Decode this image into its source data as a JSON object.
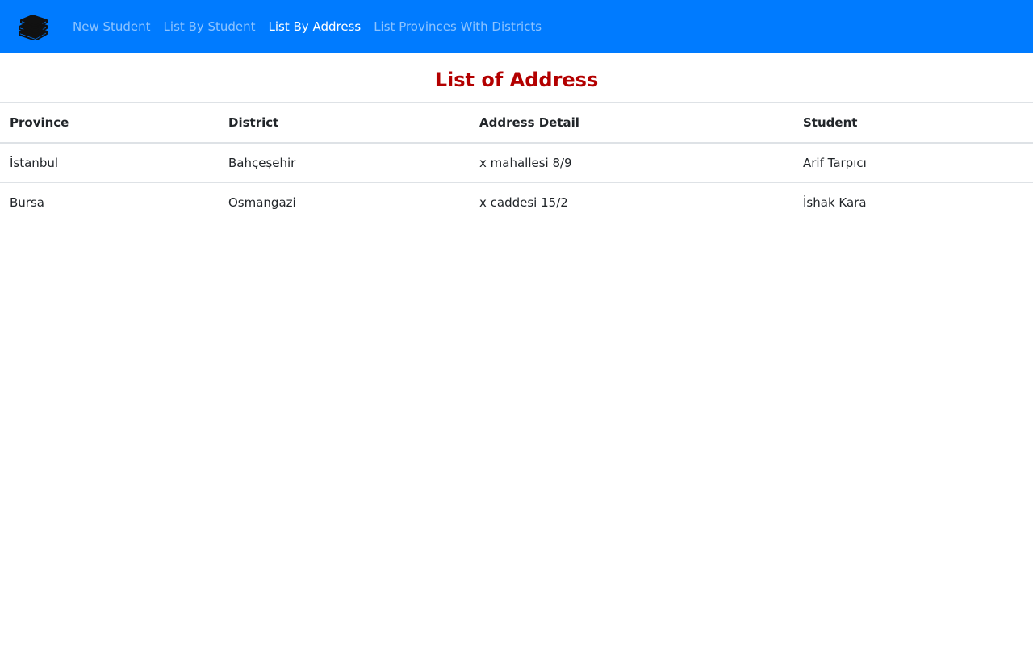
{
  "navbar": {
    "brand_icon": "books-icon",
    "links": [
      {
        "label": "New Student",
        "active": false
      },
      {
        "label": "List By Student",
        "active": false
      },
      {
        "label": "List By Address",
        "active": true
      },
      {
        "label": "List Provinces With Districts",
        "active": false
      }
    ]
  },
  "page": {
    "title": "List of Address"
  },
  "table": {
    "headers": [
      "Province",
      "District",
      "Address Detail",
      "Student"
    ],
    "rows": [
      [
        "İstanbul",
        "Bahçeşehir",
        "x mahallesi 8/9",
        "Arif Tarpıcı"
      ],
      [
        "Bursa",
        "Osmangazi",
        "x caddesi 15/2",
        "İshak Kara"
      ]
    ]
  },
  "colors": {
    "navbar_bg": "#007bff",
    "title_color": "#b30000"
  }
}
